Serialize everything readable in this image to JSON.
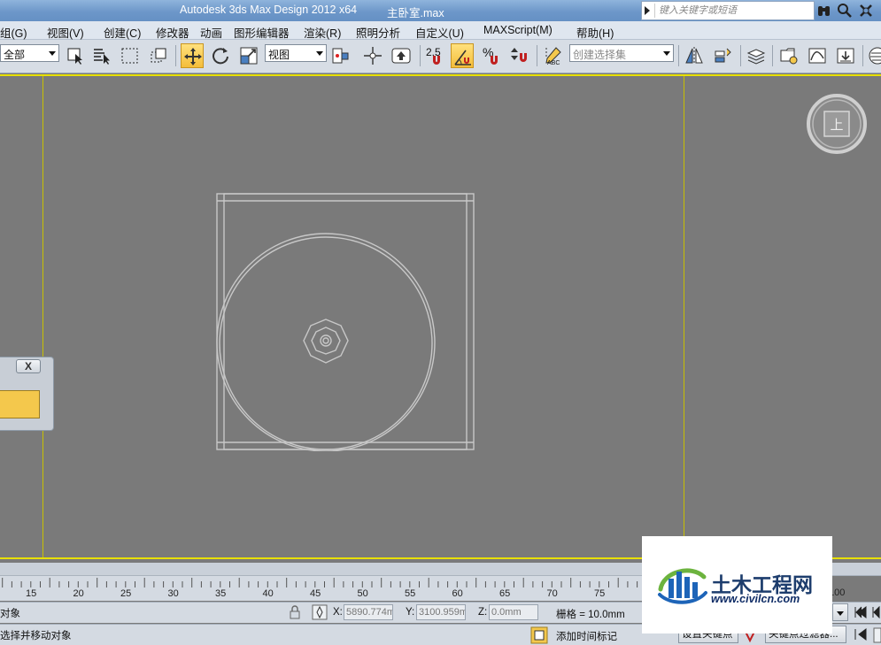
{
  "titlebar": {
    "app_title": "Autodesk 3ds Max Design 2012 x64",
    "file_name": "主卧室.max",
    "search_placeholder": "键入关键字或短语"
  },
  "menu": {
    "items": [
      "组(G)",
      "视图(V)",
      "创建(C)",
      "修改器",
      "动画",
      "图形编辑器",
      "渲染(R)",
      "照明分析",
      "自定义(U)",
      "MAXScript(M)",
      "帮助(H)"
    ]
  },
  "toolbar": {
    "filter_value": "全部",
    "ref_coord_value": "视图",
    "snap_value": "2.5",
    "angle_snap_label": "%",
    "selection_set_placeholder": "创建选择集",
    "abc_label": "ABC"
  },
  "dialog": {
    "close_label": "X",
    "colour": "#f4c84c"
  },
  "trackbar": {
    "ticks": [
      "15",
      "20",
      "25",
      "30",
      "35",
      "40",
      "45",
      "50",
      "55",
      "60",
      "65",
      "70",
      "75"
    ],
    "end_tick": "100"
  },
  "status": {
    "selection_text": "对象",
    "prompt_text": "选择并移动对象",
    "x_label": "X:",
    "x_value": "5890.774m",
    "y_label": "Y:",
    "y_value": "3100.959m",
    "z_label": "Z:",
    "z_value": "0.0mm",
    "grid_text": "栅格 = 10.0mm",
    "add_time_tag": "添加时间标记",
    "set_key_label": "设置关键点",
    "key_filters_label": "关键点过滤器..."
  },
  "viewcube": {
    "face_label": "上"
  },
  "watermark": {
    "name": "土木工程网",
    "url": "www.civilcn.com"
  },
  "colors": {
    "viewport_bg": "#7a7a7a",
    "safe_frame": "#e8e000",
    "wireframe": "#c8c8c8",
    "title_bar": "#6d97c9",
    "active_tool": "#f4bd3a"
  }
}
